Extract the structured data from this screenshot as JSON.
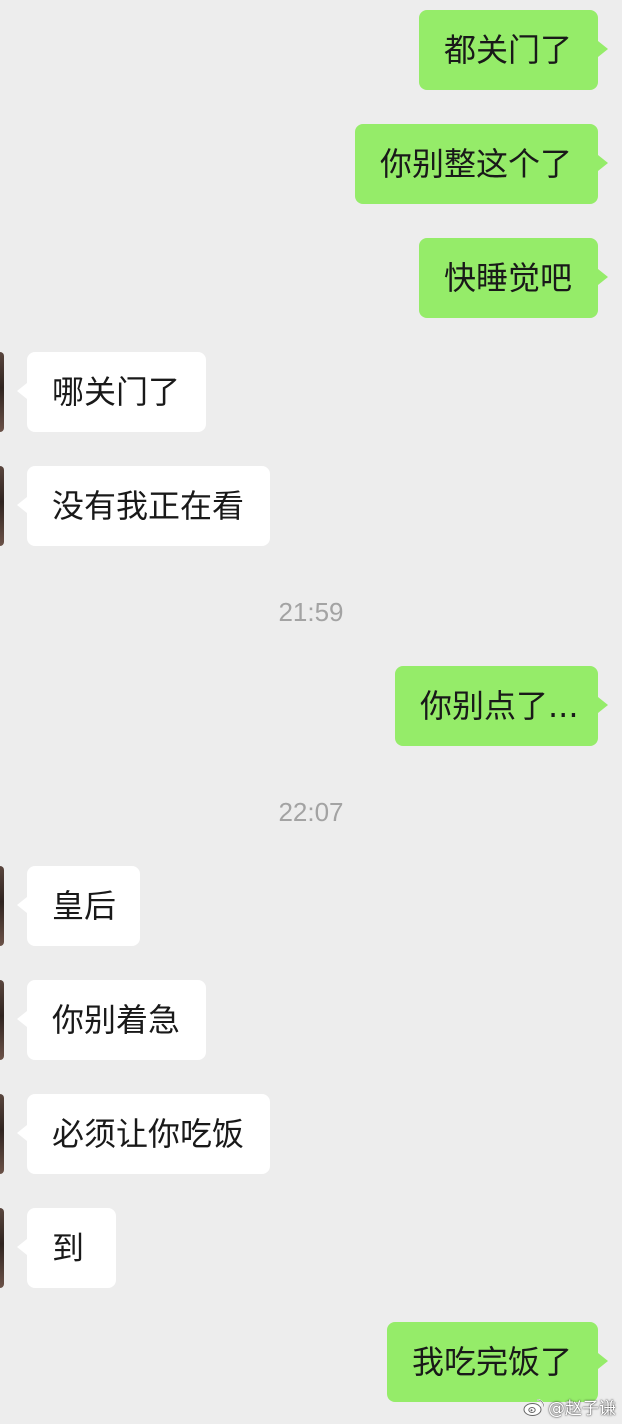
{
  "colors": {
    "background": "#ededed",
    "outgoing_bubble": "#95ec69",
    "incoming_bubble": "#ffffff",
    "message_text": "#191919",
    "timestamp_text": "#a3a3a3"
  },
  "conversation": [
    {
      "outgoing": "都关门了"
    },
    {
      "outgoing": "你别整这个了"
    },
    {
      "outgoing": "快睡觉吧"
    },
    {
      "incoming": "哪关门了"
    },
    {
      "incoming": "没有我正在看"
    },
    {
      "time": "21:59"
    },
    {
      "outgoing": "你别点了..."
    },
    {
      "time": "22:07"
    },
    {
      "incoming": "皇后"
    },
    {
      "incoming": "你别着急"
    },
    {
      "incoming": "必须让你吃饭"
    },
    {
      "incoming": "到"
    },
    {
      "outgoing": "我吃完饭了"
    }
  ],
  "watermark": {
    "icon": "weibo-logo-icon",
    "text": "@赵子谦"
  }
}
